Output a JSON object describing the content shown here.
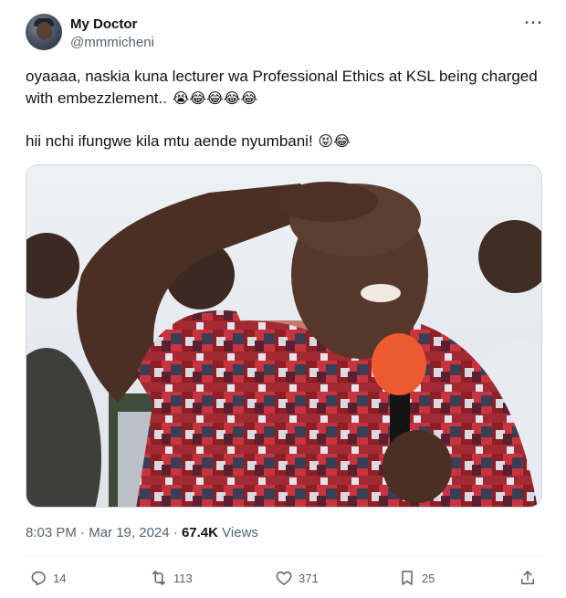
{
  "author": {
    "display_name": "My Doctor",
    "handle": "@mmmicheni"
  },
  "tweet": {
    "line1_text": "oyaaaa, naskia kuna lecturer wa Professional Ethics at KSL being charged with embezzlement..",
    "line1_emojis": "😭😂😂😂😂",
    "line2_text": "hii nchi ifungwe kila mtu aende nyumbani!",
    "line2_emojis": "😝😂"
  },
  "meta": {
    "time": "8:03 PM",
    "separator": "·",
    "date": "Mar 19, 2024",
    "views_count": "67.4K",
    "views_label": "Views"
  },
  "actions": {
    "replies": "14",
    "reposts": "113",
    "likes": "371",
    "bookmarks": "25"
  },
  "icons": {
    "more": "more-horizontal-icon",
    "reply": "reply-icon",
    "repost": "repost-icon",
    "like": "heart-icon",
    "bookmark": "bookmark-icon",
    "share": "share-icon"
  },
  "colors": {
    "text_primary": "#0f1419",
    "text_secondary": "#536471",
    "border": "#cfd9de"
  }
}
